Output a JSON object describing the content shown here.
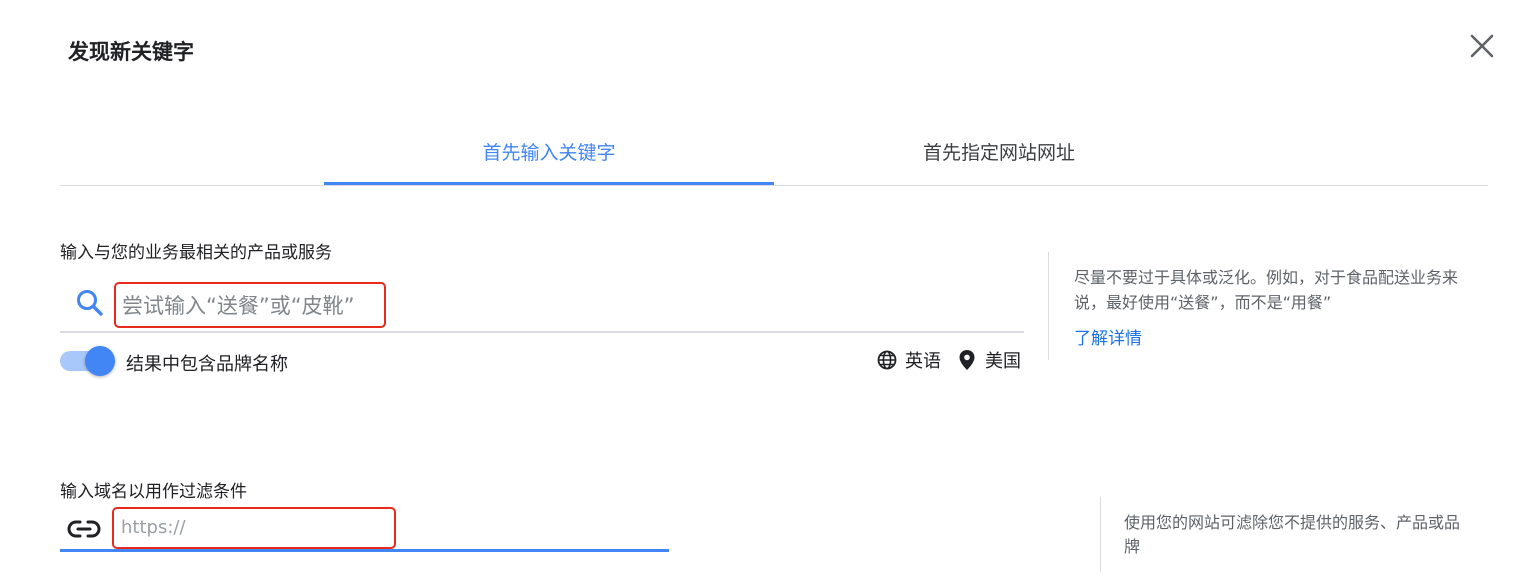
{
  "dialog": {
    "title": "发现新关键字",
    "close_icon": "close-icon"
  },
  "tabs": [
    {
      "label": "首先输入关键字",
      "active": true
    },
    {
      "label": "首先指定网站网址",
      "active": false
    }
  ],
  "keywords_section": {
    "label": "输入与您的业务最相关的产品或服务",
    "search_icon": "search-icon",
    "placeholder": "尝试输入“送餐”或“皮靴”",
    "value": "",
    "include_brands_label": "结果中包含品牌名称",
    "include_brands_on": true,
    "language": "英语",
    "location": "美国",
    "hint": "尽量不要过于具体或泛化。例如，对于食品配送业务来说，最好使用“送餐”，而不是“用餐”",
    "learn_more": "了解详情"
  },
  "domain_section": {
    "label": "输入域名以用作过滤条件",
    "link_icon": "link-icon",
    "placeholder": "https://",
    "value": "",
    "hint": "使用您的网站可滤除您不提供的服务、产品或品牌"
  },
  "colors": {
    "accent": "#4285f4",
    "highlight_border": "#e8291c",
    "link": "#1a73e8"
  }
}
